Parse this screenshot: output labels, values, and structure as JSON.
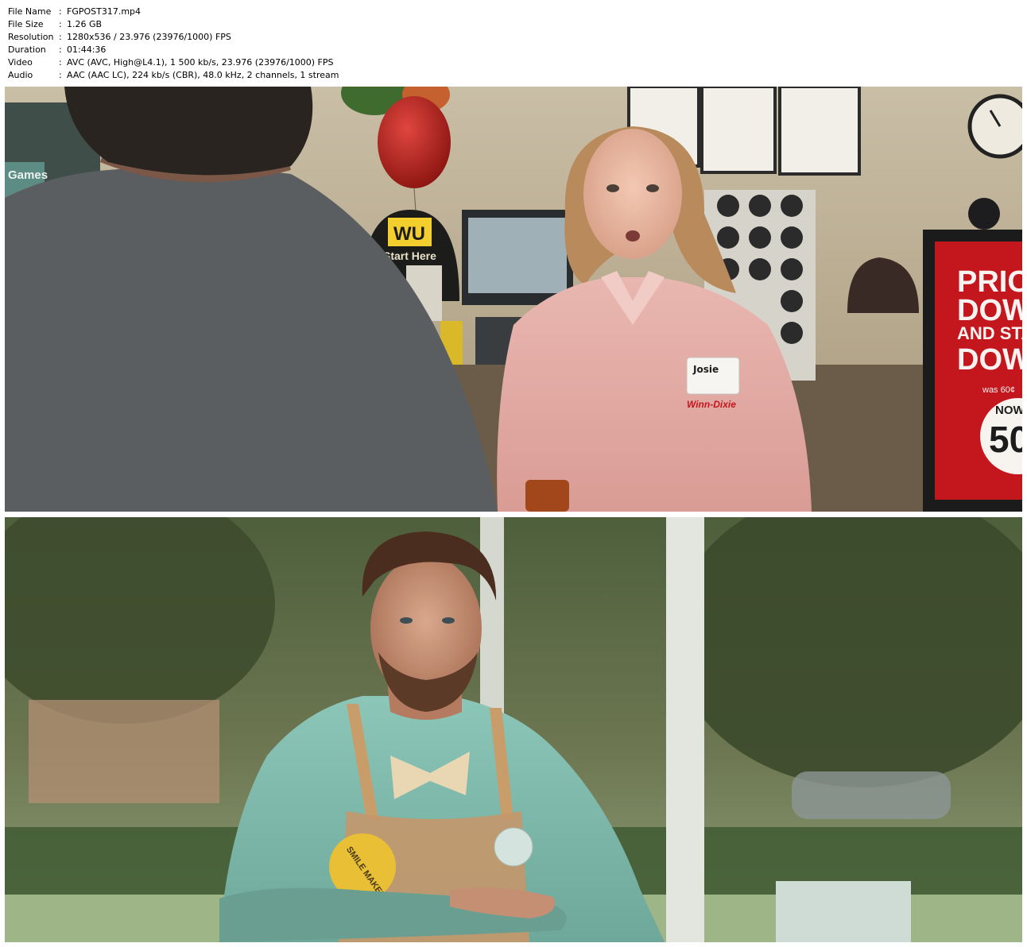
{
  "media_info": [
    {
      "key": "File Name",
      "value": "FGPOST317.mp4"
    },
    {
      "key": "File Size",
      "value": "1.26 GB"
    },
    {
      "key": "Resolution",
      "value": "1280x536 / 23.976 (23976/1000) FPS"
    },
    {
      "key": "Duration",
      "value": "01:44:36"
    },
    {
      "key": "Video",
      "value": "AVC (AVC, High@L4.1), 1 500 kb/s, 23.976 (23976/1000) FPS"
    },
    {
      "key": "Audio",
      "value": "AAC (AAC LC), 224 kb/s (CBR), 48.0 kHz, 2 channels, 1 stream"
    }
  ],
  "separator": ":",
  "frame1": {
    "wu_logo": "WU",
    "wu_sign_text": "Start Here",
    "games_sign": "Games",
    "name_tag": "Josie",
    "store_logo": "Winn-Dixie",
    "promo_lines": [
      "PRIC",
      "DOW",
      "AND STA",
      "DOW"
    ],
    "promo_was": "was 60¢",
    "promo_now": "NOW",
    "promo_price": "50"
  },
  "frame2": {
    "button_text": "SMILE MAKER"
  }
}
